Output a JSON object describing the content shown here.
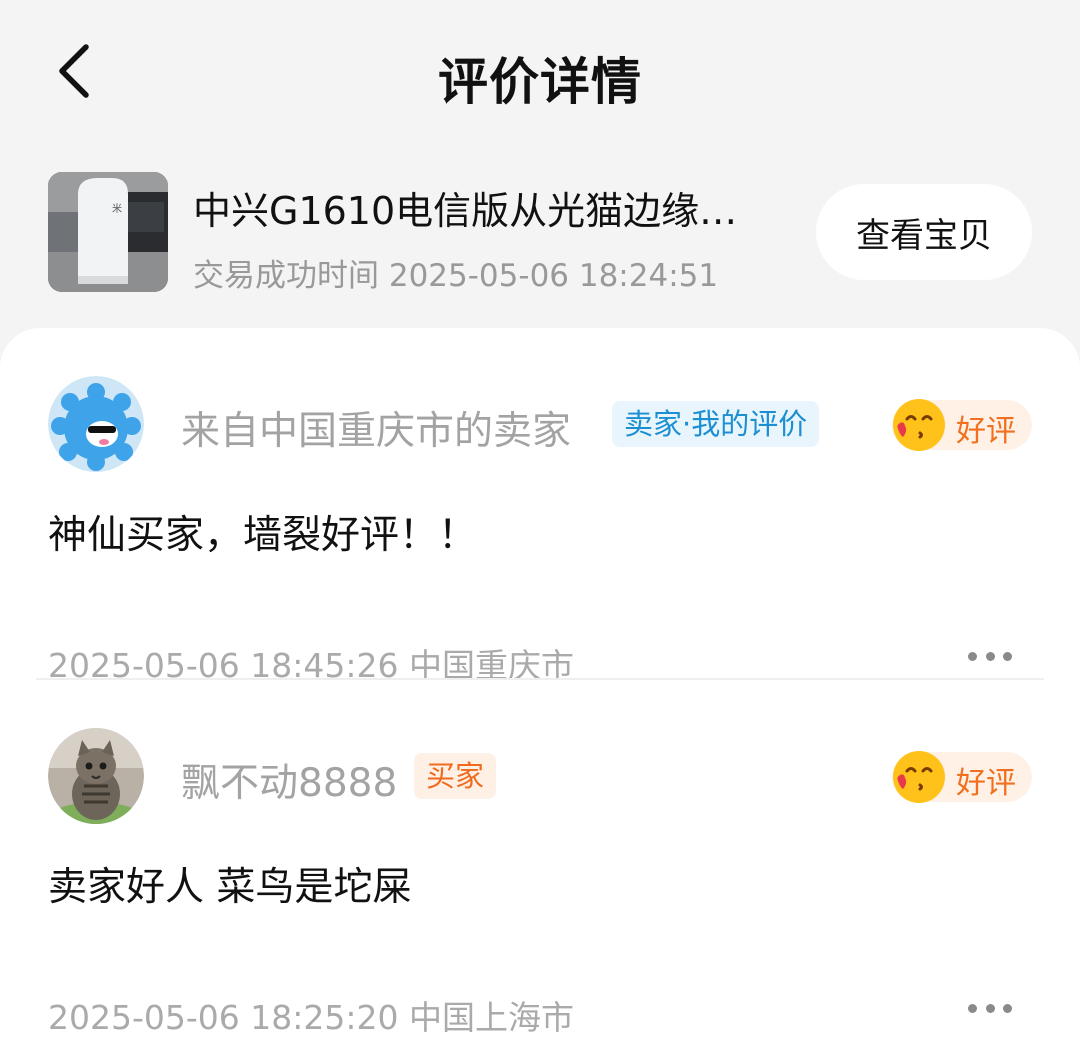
{
  "header": {
    "title": "评价详情",
    "back_icon": "chevron-left-icon"
  },
  "product": {
    "title": "中兴G1610电信版从光猫边缘…",
    "trade_time": "交易成功时间 2025-05-06 18:24:51",
    "view_button": "查看宝贝"
  },
  "reviews": [
    {
      "username": "来自中国重庆市的卖家",
      "role": "卖家·我的评价",
      "role_color": "#1b8fd2",
      "rating": "好评",
      "content": "神仙买家，墙裂好评！！",
      "meta": "2025-05-06 18:45:26  中国重庆市"
    },
    {
      "username": "飘不动8888",
      "role": "买家",
      "role_color": "#f06a1e",
      "rating": "好评",
      "content": "卖家好人 菜鸟是坨屎",
      "meta": "2025-05-06 18:25:20  中国上海市"
    }
  ],
  "colors": {
    "background": "#f4f4f4",
    "card": "#ffffff",
    "rating_accent": "#f0701f"
  }
}
